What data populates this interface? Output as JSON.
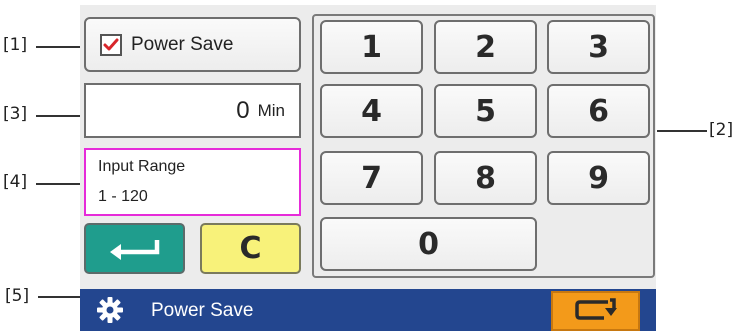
{
  "callouts": {
    "c1": "[1]",
    "c2": "[2]",
    "c3": "[3]",
    "c4": "[4]",
    "c5": "[5]"
  },
  "power_save_toggle": {
    "label": "Power Save",
    "checked": true
  },
  "time_field": {
    "value": "0",
    "unit": "Min"
  },
  "input_range": {
    "title": "Input Range",
    "range": "1 - 120"
  },
  "actions": {
    "enter_icon": "return-arrow-icon",
    "clear_label": "C"
  },
  "keypad": {
    "keys": [
      "1",
      "2",
      "3",
      "4",
      "5",
      "6",
      "7",
      "8",
      "9",
      "0"
    ]
  },
  "footer": {
    "title": "Power Save",
    "settings_icon": "gear-icon",
    "back_icon": "return-icon"
  },
  "colors": {
    "check_mark": "#d8262b",
    "range_border": "#e62bd9",
    "enter_button": "#1f9d8d",
    "clear_button": "#f8f27a",
    "footer_bar": "#23468f",
    "footer_button": "#f39a1a"
  }
}
